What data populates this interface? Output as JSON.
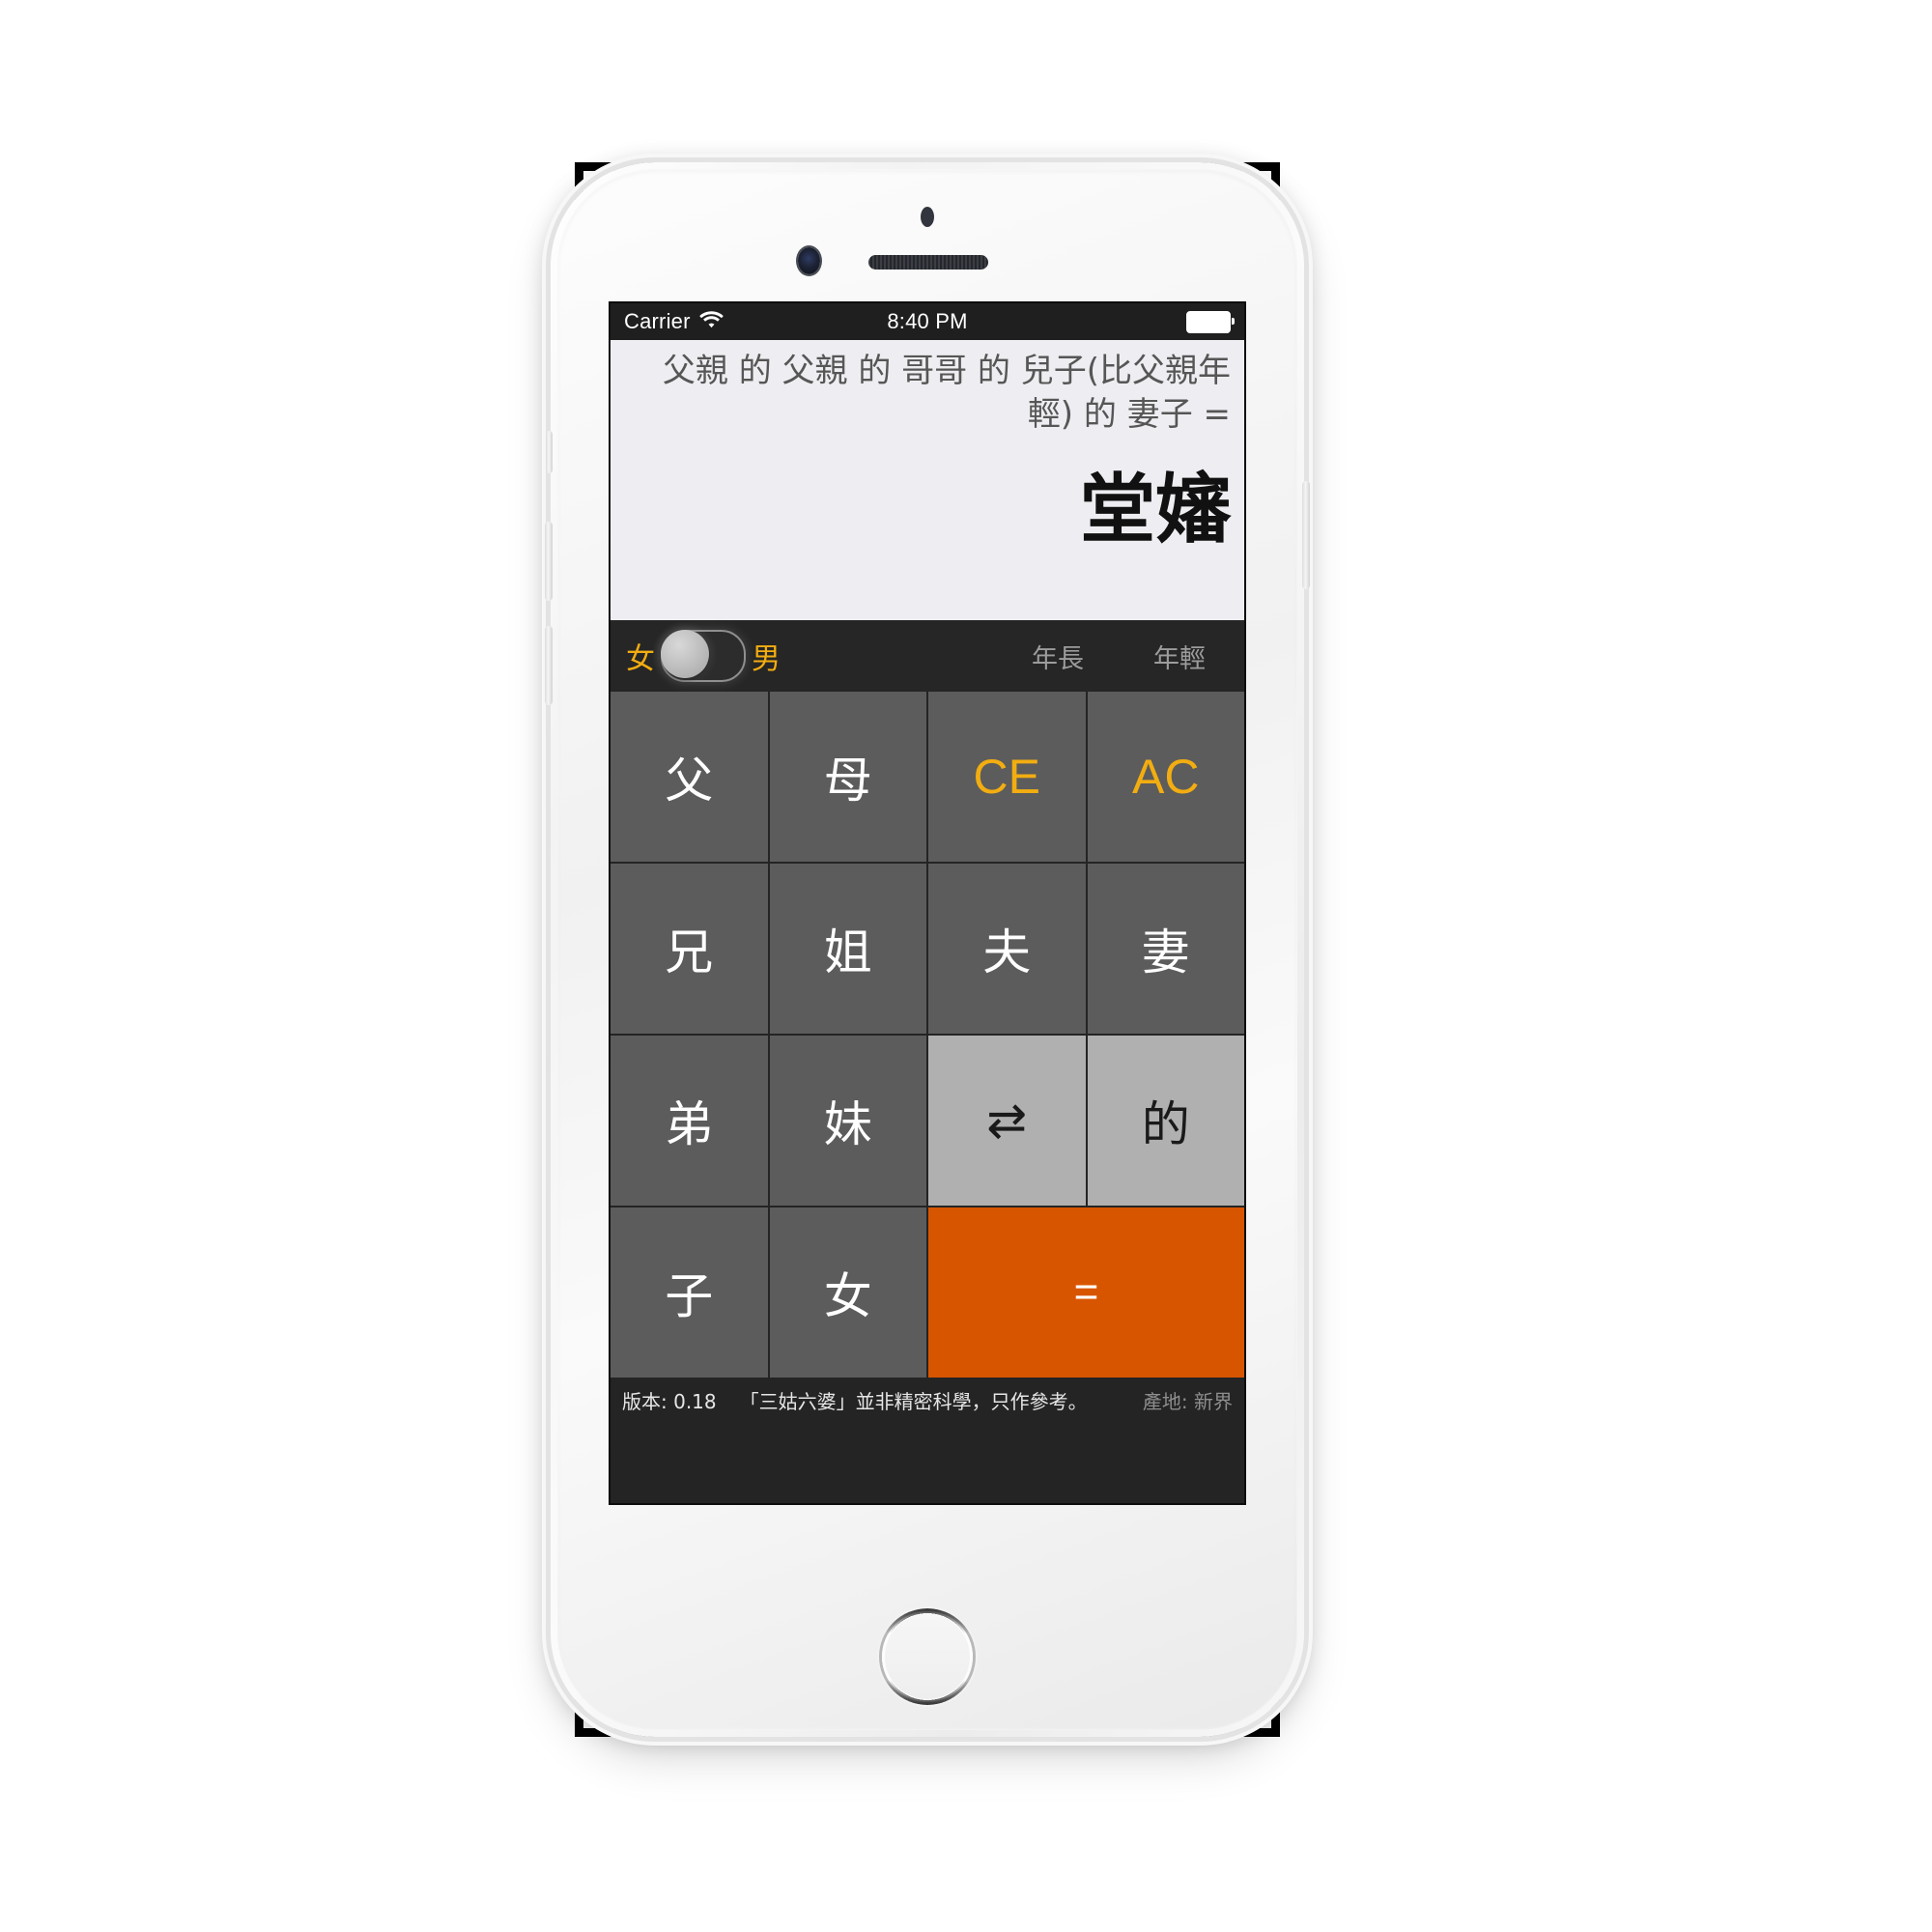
{
  "status_bar": {
    "carrier": "Carrier",
    "wifi_icon": "wifi-icon",
    "time": "8:40 PM",
    "battery_icon": "battery-full-icon"
  },
  "display": {
    "expression": "父親 的 父親 的 哥哥 的 兒子(比父親年輕) 的 妻子 =",
    "result": "堂嬸"
  },
  "mode_bar": {
    "female_label": "女",
    "male_label": "男",
    "switch_state": "female",
    "elder_label": "年長",
    "younger_label": "年輕"
  },
  "keypad": {
    "keys": [
      {
        "label": "父",
        "style": "k-dark",
        "name": "key-father"
      },
      {
        "label": "母",
        "style": "k-dark",
        "name": "key-mother"
      },
      {
        "label": "CE",
        "style": "k-accent",
        "name": "key-clear-entry"
      },
      {
        "label": "AC",
        "style": "k-accent",
        "name": "key-all-clear"
      },
      {
        "label": "兄",
        "style": "k-dark",
        "name": "key-elder-brother"
      },
      {
        "label": "姐",
        "style": "k-dark",
        "name": "key-elder-sister"
      },
      {
        "label": "夫",
        "style": "k-dark",
        "name": "key-husband"
      },
      {
        "label": "妻",
        "style": "k-dark",
        "name": "key-wife"
      },
      {
        "label": "弟",
        "style": "k-dark",
        "name": "key-younger-brother"
      },
      {
        "label": "妹",
        "style": "k-dark",
        "name": "key-younger-sister"
      },
      {
        "label": "⇄",
        "style": "k-light",
        "name": "key-swap-icon"
      },
      {
        "label": "的",
        "style": "k-light",
        "name": "key-possessive"
      },
      {
        "label": "子",
        "style": "k-dark",
        "name": "key-son"
      },
      {
        "label": "女",
        "style": "k-dark",
        "name": "key-daughter"
      },
      {
        "label": "=",
        "style": "k-equals",
        "name": "key-equals"
      }
    ]
  },
  "footer": {
    "version": "版本: 0.18",
    "note": "「三姑六婆」並非精密科學，只作參考。",
    "origin": "產地: 新界"
  },
  "colors": {
    "accent_orange": "#f2ad11",
    "equals_orange": "#d85500",
    "key_dark": "#5c5c5c",
    "key_light": "#b0b0b0",
    "screen_bg": "#242424",
    "display_bg": "#eeeef2"
  }
}
